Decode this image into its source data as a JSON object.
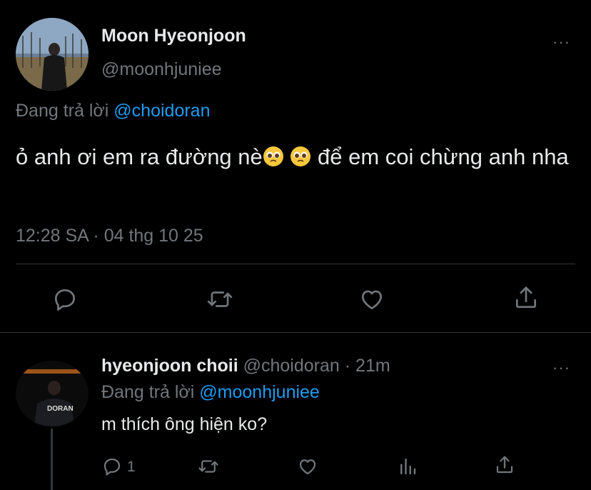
{
  "main_tweet": {
    "author_name": "Moon Hyeonjoon",
    "author_handle": "@moonhjuniee",
    "replying_prefix": "Đang trả lời",
    "replying_to": "@choidoran",
    "text_part1": "ỏ anh ơi em ra đường nè",
    "text_part2": "  để em coi chừng anh nha",
    "timestamp": "12:28 SA · 04 thg 10 25",
    "actions": [
      "reply-icon",
      "retweet-icon",
      "like-icon",
      "share-icon"
    ]
  },
  "reply": {
    "author_name": "hyeonjoon choii",
    "author_handle": "@choidoran",
    "time": "· 21m",
    "replying_prefix": "Đang trả lời",
    "replying_to": "@moonhjuniee",
    "text": "m thích ông hiện ko?",
    "reply_count": "1",
    "actions": [
      "reply-icon",
      "retweet-icon",
      "like-icon",
      "views-icon",
      "share-icon"
    ],
    "avatar_jersey_text": "DORAN"
  },
  "more_label": "···",
  "colors": {
    "background": "#000000",
    "text": "#e7e9ea",
    "muted": "#71767b",
    "link": "#1d9bf0",
    "divider": "#2f3336",
    "emoji": "#f9c73c"
  }
}
